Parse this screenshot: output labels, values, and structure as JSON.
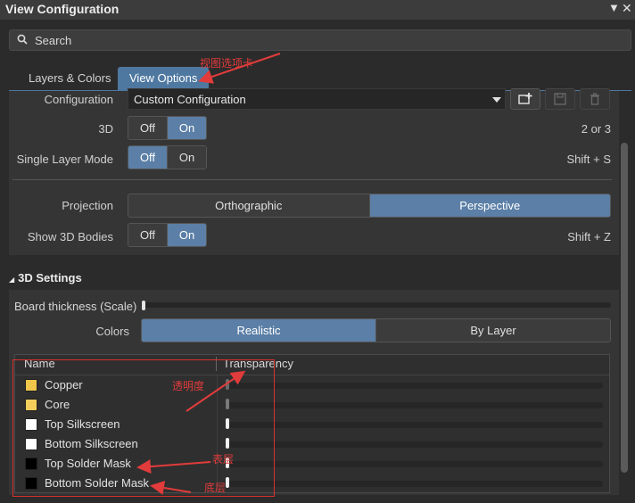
{
  "window": {
    "title": "View Configuration",
    "pin_icon": "dropdown-arrow-icon",
    "close_icon": "close-icon"
  },
  "search": {
    "placeholder": "Search",
    "icon": "search-icon"
  },
  "tabs": [
    {
      "label": "Layers & Colors",
      "active": false
    },
    {
      "label": "View Options",
      "active": true
    }
  ],
  "view_options": {
    "configuration_label": "Configuration",
    "configuration_value": "Custom Configuration",
    "icon_buttons": [
      "add-config-icon",
      "save-icon",
      "delete-icon"
    ],
    "mode_3d": {
      "label": "3D",
      "off": "Off",
      "on": "On",
      "selected": "On",
      "shortcut": "2 or 3"
    },
    "single_layer": {
      "label": "Single Layer Mode",
      "off": "Off",
      "on": "On",
      "selected": "Off",
      "shortcut": "Shift + S"
    },
    "projection": {
      "label": "Projection",
      "a": "Orthographic",
      "b": "Perspective",
      "selected": "Perspective"
    },
    "bodies": {
      "label": "Show 3D Bodies",
      "off": "Off",
      "on": "On",
      "selected": "On",
      "shortcut": "Shift + Z"
    }
  },
  "settings_3d": {
    "header": "3D Settings",
    "board_thickness_label": "Board thickness (Scale)",
    "board_thickness_value": 0,
    "colors_label": "Colors",
    "colors_a": "Realistic",
    "colors_b": "By Layer",
    "colors_selected": "Realistic",
    "table_headers": {
      "name": "Name",
      "transparency": "Transparency"
    },
    "rows": [
      {
        "name": "Copper",
        "color": "#f0c64a",
        "transparency": 0
      },
      {
        "name": "Core",
        "color": "#f2cf5c",
        "transparency": 0
      },
      {
        "name": "Top Silkscreen",
        "color": "#ffffff",
        "transparency": 0
      },
      {
        "name": "Bottom Silkscreen",
        "color": "#ffffff",
        "transparency": 0
      },
      {
        "name": "Top Solder Mask",
        "color": "#000000",
        "transparency": 0
      },
      {
        "name": "Bottom Solder Mask",
        "color": "#000000",
        "transparency": 0
      }
    ]
  },
  "annotations": {
    "view_options": "视图选项卡",
    "transparency": "透明度",
    "top_layer": "表层",
    "bottom_layer": "底层",
    "color": "#e23b3b"
  }
}
